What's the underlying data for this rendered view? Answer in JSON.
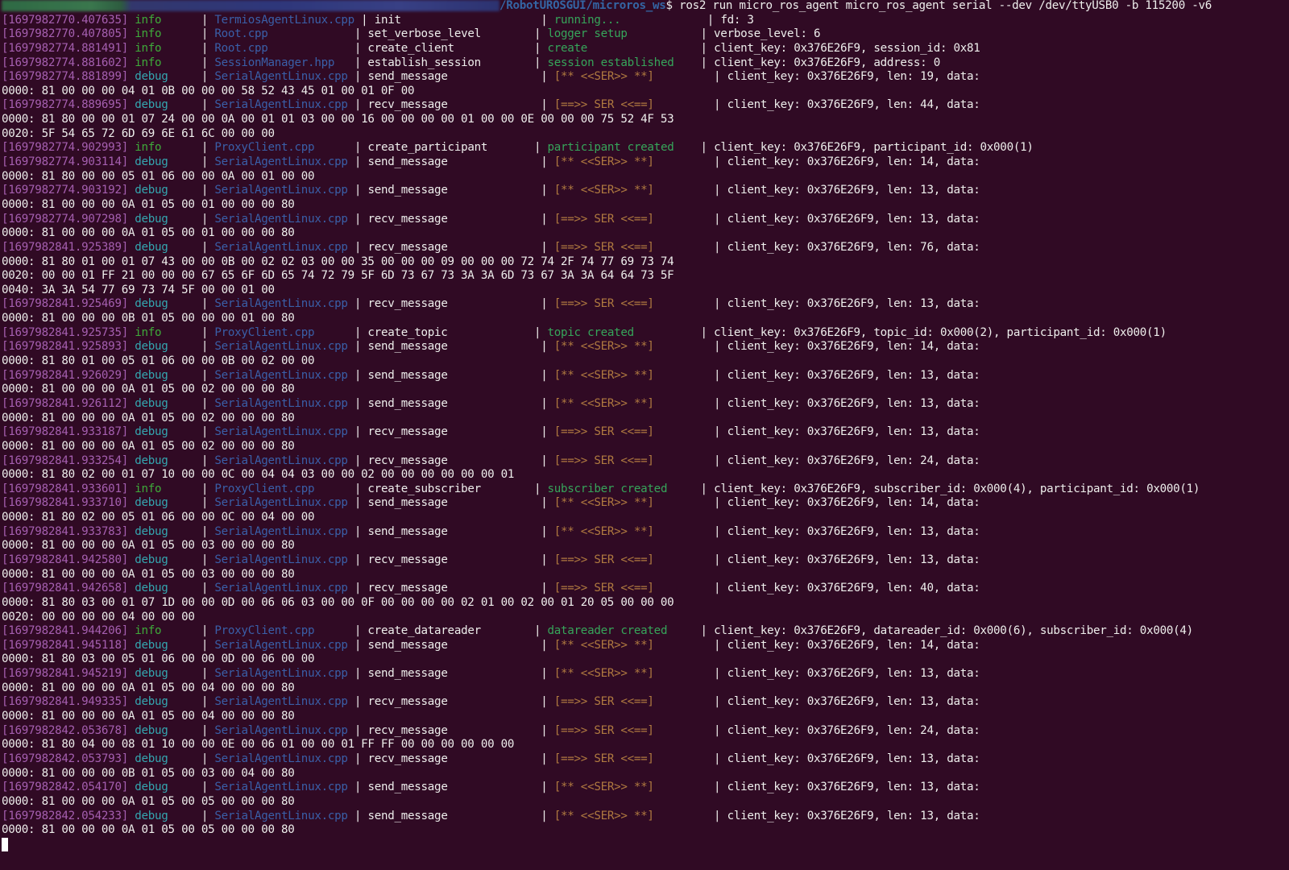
{
  "window": {
    "prompt_path_visible": "/RobotUROSGUI/microros_ws",
    "prompt_symbol": "$",
    "command": "ros2 run micro_ros_agent micro_ros_agent serial --dev /dev/ttyUSB0 -b 115200 -v6"
  },
  "colors": {
    "background": "#300a24",
    "timestamp": "#a55fb0",
    "level_info": "#3eaa3a",
    "level_debug": "#34a6b0",
    "file": "#3a5fa8",
    "event_info": "#36a55a",
    "event_io": "#b07a40",
    "text": "#eeeeec"
  },
  "log": [
    {
      "ts": "[1697982770.407635]",
      "level": "info",
      "file": "TermiosAgentLinux.cpp",
      "func": "init",
      "event": "running...",
      "details": "fd: 3",
      "hex": []
    },
    {
      "ts": "[1697982770.407805]",
      "level": "info",
      "file": "Root.cpp",
      "func": "set_verbose_level",
      "event": "logger setup",
      "details": "verbose_level: 6",
      "hex": []
    },
    {
      "ts": "[1697982774.881491]",
      "level": "info",
      "file": "Root.cpp",
      "func": "create_client",
      "event": "create",
      "details": "client_key: 0x376E26F9, session_id: 0x81",
      "hex": []
    },
    {
      "ts": "[1697982774.881602]",
      "level": "info",
      "file": "SessionManager.hpp",
      "func": "establish_session",
      "event": "session established",
      "details": "client_key: 0x376E26F9, address: 0",
      "hex": []
    },
    {
      "ts": "[1697982774.881899]",
      "level": "debug",
      "file": "SerialAgentLinux.cpp",
      "func": "send_message",
      "event": "[** <<SER>> **]",
      "details": "client_key: 0x376E26F9, len: 19, data:",
      "hex": [
        "0000: 81 00 00 00 04 01 0B 00 00 00 58 52 43 45 01 00 01 0F 00"
      ]
    },
    {
      "ts": "[1697982774.889695]",
      "level": "debug",
      "file": "SerialAgentLinux.cpp",
      "func": "recv_message",
      "event": "[==>> SER <<==]",
      "details": "client_key: 0x376E26F9, len: 44, data:",
      "hex": [
        "0000: 81 80 00 00 01 07 24 00 00 0A 00 01 01 03 00 00 16 00 00 00 00 01 00 00 0E 00 00 00 75 52 4F 53",
        "0020: 5F 54 65 72 6D 69 6E 61 6C 00 00 00"
      ]
    },
    {
      "ts": "[1697982774.902993]",
      "level": "info",
      "file": "ProxyClient.cpp",
      "func": "create_participant",
      "event": "participant created",
      "details": "client_key: 0x376E26F9, participant_id: 0x000(1)",
      "hex": []
    },
    {
      "ts": "[1697982774.903114]",
      "level": "debug",
      "file": "SerialAgentLinux.cpp",
      "func": "send_message",
      "event": "[** <<SER>> **]",
      "details": "client_key: 0x376E26F9, len: 14, data:",
      "hex": [
        "0000: 81 80 00 00 05 01 06 00 00 0A 00 01 00 00"
      ]
    },
    {
      "ts": "[1697982774.903192]",
      "level": "debug",
      "file": "SerialAgentLinux.cpp",
      "func": "send_message",
      "event": "[** <<SER>> **]",
      "details": "client_key: 0x376E26F9, len: 13, data:",
      "hex": [
        "0000: 81 00 00 00 0A 01 05 00 01 00 00 00 80"
      ]
    },
    {
      "ts": "[1697982774.907298]",
      "level": "debug",
      "file": "SerialAgentLinux.cpp",
      "func": "recv_message",
      "event": "[==>> SER <<==]",
      "details": "client_key: 0x376E26F9, len: 13, data:",
      "hex": [
        "0000: 81 00 00 00 0A 01 05 00 01 00 00 00 80"
      ]
    },
    {
      "ts": "[1697982841.925389]",
      "level": "debug",
      "file": "SerialAgentLinux.cpp",
      "func": "recv_message",
      "event": "[==>> SER <<==]",
      "details": "client_key: 0x376E26F9, len: 76, data:",
      "hex": [
        "0000: 81 80 01 00 01 07 43 00 00 0B 00 02 02 03 00 00 35 00 00 00 09 00 00 00 72 74 2F 74 77 69 73 74",
        "0020: 00 00 01 FF 21 00 00 00 67 65 6F 6D 65 74 72 79 5F 6D 73 67 73 3A 3A 6D 73 67 3A 3A 64 64 73 5F",
        "0040: 3A 3A 54 77 69 73 74 5F 00 00 01 00"
      ]
    },
    {
      "ts": "[1697982841.925469]",
      "level": "debug",
      "file": "SerialAgentLinux.cpp",
      "func": "recv_message",
      "event": "[==>> SER <<==]",
      "details": "client_key: 0x376E26F9, len: 13, data:",
      "hex": [
        "0000: 81 00 00 00 0B 01 05 00 00 00 01 00 80"
      ]
    },
    {
      "ts": "[1697982841.925735]",
      "level": "info",
      "file": "ProxyClient.cpp",
      "func": "create_topic",
      "event": "topic created",
      "details": "client_key: 0x376E26F9, topic_id: 0x000(2), participant_id: 0x000(1)",
      "hex": []
    },
    {
      "ts": "[1697982841.925893]",
      "level": "debug",
      "file": "SerialAgentLinux.cpp",
      "func": "send_message",
      "event": "[** <<SER>> **]",
      "details": "client_key: 0x376E26F9, len: 14, data:",
      "hex": [
        "0000: 81 80 01 00 05 01 06 00 00 0B 00 02 00 00"
      ]
    },
    {
      "ts": "[1697982841.926029]",
      "level": "debug",
      "file": "SerialAgentLinux.cpp",
      "func": "send_message",
      "event": "[** <<SER>> **]",
      "details": "client_key: 0x376E26F9, len: 13, data:",
      "hex": [
        "0000: 81 00 00 00 0A 01 05 00 02 00 00 00 80"
      ]
    },
    {
      "ts": "[1697982841.926112]",
      "level": "debug",
      "file": "SerialAgentLinux.cpp",
      "func": "send_message",
      "event": "[** <<SER>> **]",
      "details": "client_key: 0x376E26F9, len: 13, data:",
      "hex": [
        "0000: 81 00 00 00 0A 01 05 00 02 00 00 00 80"
      ]
    },
    {
      "ts": "[1697982841.933187]",
      "level": "debug",
      "file": "SerialAgentLinux.cpp",
      "func": "recv_message",
      "event": "[==>> SER <<==]",
      "details": "client_key: 0x376E26F9, len: 13, data:",
      "hex": [
        "0000: 81 00 00 00 0A 01 05 00 02 00 00 00 80"
      ]
    },
    {
      "ts": "[1697982841.933254]",
      "level": "debug",
      "file": "SerialAgentLinux.cpp",
      "func": "recv_message",
      "event": "[==>> SER <<==]",
      "details": "client_key: 0x376E26F9, len: 24, data:",
      "hex": [
        "0000: 81 80 02 00 01 07 10 00 00 0C 00 04 04 03 00 00 02 00 00 00 00 00 00 01"
      ]
    },
    {
      "ts": "[1697982841.933601]",
      "level": "info",
      "file": "ProxyClient.cpp",
      "func": "create_subscriber",
      "event": "subscriber created",
      "details": "client_key: 0x376E26F9, subscriber_id: 0x000(4), participant_id: 0x000(1)",
      "hex": []
    },
    {
      "ts": "[1697982841.933710]",
      "level": "debug",
      "file": "SerialAgentLinux.cpp",
      "func": "send_message",
      "event": "[** <<SER>> **]",
      "details": "client_key: 0x376E26F9, len: 14, data:",
      "hex": [
        "0000: 81 80 02 00 05 01 06 00 00 0C 00 04 00 00"
      ]
    },
    {
      "ts": "[1697982841.933783]",
      "level": "debug",
      "file": "SerialAgentLinux.cpp",
      "func": "send_message",
      "event": "[** <<SER>> **]",
      "details": "client_key: 0x376E26F9, len: 13, data:",
      "hex": [
        "0000: 81 00 00 00 0A 01 05 00 03 00 00 00 80"
      ]
    },
    {
      "ts": "[1697982841.942580]",
      "level": "debug",
      "file": "SerialAgentLinux.cpp",
      "func": "recv_message",
      "event": "[==>> SER <<==]",
      "details": "client_key: 0x376E26F9, len: 13, data:",
      "hex": [
        "0000: 81 00 00 00 0A 01 05 00 03 00 00 00 80"
      ]
    },
    {
      "ts": "[1697982841.942658]",
      "level": "debug",
      "file": "SerialAgentLinux.cpp",
      "func": "recv_message",
      "event": "[==>> SER <<==]",
      "details": "client_key: 0x376E26F9, len: 40, data:",
      "hex": [
        "0000: 81 80 03 00 01 07 1D 00 00 0D 00 06 06 03 00 00 0F 00 00 00 00 02 01 00 02 00 01 20 05 00 00 00",
        "0020: 00 00 00 00 04 00 00 00"
      ]
    },
    {
      "ts": "[1697982841.944206]",
      "level": "info",
      "file": "ProxyClient.cpp",
      "func": "create_datareader",
      "event": "datareader created",
      "details": "client_key: 0x376E26F9, datareader_id: 0x000(6), subscriber_id: 0x000(4)",
      "hex": []
    },
    {
      "ts": "[1697982841.945118]",
      "level": "debug",
      "file": "SerialAgentLinux.cpp",
      "func": "send_message",
      "event": "[** <<SER>> **]",
      "details": "client_key: 0x376E26F9, len: 14, data:",
      "hex": [
        "0000: 81 80 03 00 05 01 06 00 00 0D 00 06 00 00"
      ]
    },
    {
      "ts": "[1697982841.945219]",
      "level": "debug",
      "file": "SerialAgentLinux.cpp",
      "func": "send_message",
      "event": "[** <<SER>> **]",
      "details": "client_key: 0x376E26F9, len: 13, data:",
      "hex": [
        "0000: 81 00 00 00 0A 01 05 00 04 00 00 00 80"
      ]
    },
    {
      "ts": "[1697982841.949335]",
      "level": "debug",
      "file": "SerialAgentLinux.cpp",
      "func": "recv_message",
      "event": "[==>> SER <<==]",
      "details": "client_key: 0x376E26F9, len: 13, data:",
      "hex": [
        "0000: 81 00 00 00 0A 01 05 00 04 00 00 00 80"
      ]
    },
    {
      "ts": "[1697982842.053678]",
      "level": "debug",
      "file": "SerialAgentLinux.cpp",
      "func": "recv_message",
      "event": "[==>> SER <<==]",
      "details": "client_key: 0x376E26F9, len: 24, data:",
      "hex": [
        "0000: 81 80 04 00 08 01 10 00 00 0E 00 06 01 00 00 01 FF FF 00 00 00 00 00 00"
      ]
    },
    {
      "ts": "[1697982842.053793]",
      "level": "debug",
      "file": "SerialAgentLinux.cpp",
      "func": "recv_message",
      "event": "[==>> SER <<==]",
      "details": "client_key: 0x376E26F9, len: 13, data:",
      "hex": [
        "0000: 81 00 00 00 0B 01 05 00 03 00 04 00 80"
      ]
    },
    {
      "ts": "[1697982842.054170]",
      "level": "debug",
      "file": "SerialAgentLinux.cpp",
      "func": "send_message",
      "event": "[** <<SER>> **]",
      "details": "client_key: 0x376E26F9, len: 13, data:",
      "hex": [
        "0000: 81 00 00 00 0A 01 05 00 05 00 00 00 80"
      ]
    },
    {
      "ts": "[1697982842.054233]",
      "level": "debug",
      "file": "SerialAgentLinux.cpp",
      "func": "send_message",
      "event": "[** <<SER>> **]",
      "details": "client_key: 0x376E26F9, len: 13, data:",
      "hex": [
        "0000: 81 00 00 00 0A 01 05 00 05 00 00 00 80"
      ]
    }
  ]
}
